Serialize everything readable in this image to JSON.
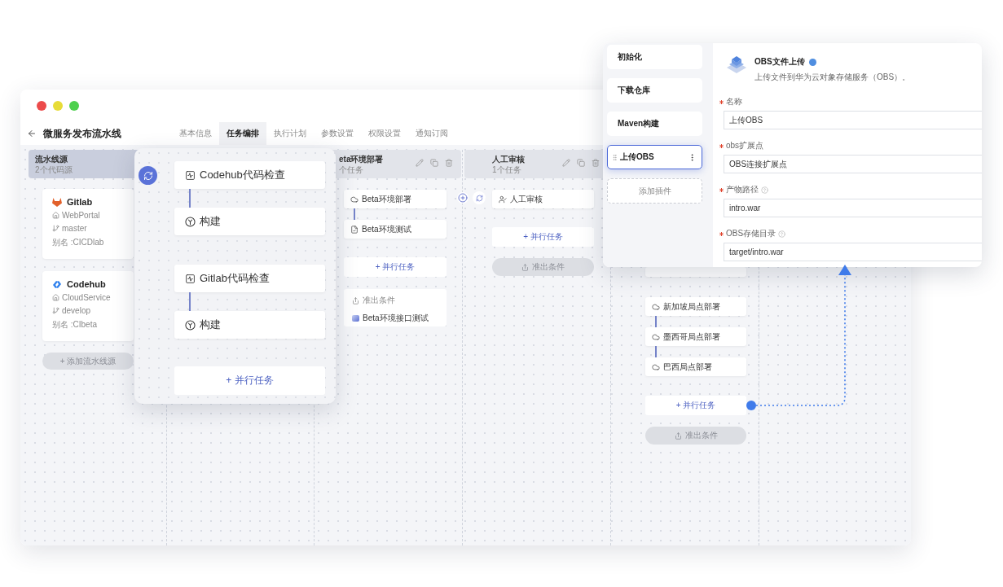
{
  "window": {
    "title": "微服务发布流水线",
    "tabs": [
      {
        "label": "基本信息",
        "selected": false
      },
      {
        "label": "任务编排",
        "selected": true
      },
      {
        "label": "执行计划",
        "selected": false
      },
      {
        "label": "参数设置",
        "selected": false
      },
      {
        "label": "权限设置",
        "selected": false
      },
      {
        "label": "通知订阅",
        "selected": false
      }
    ]
  },
  "source_column": {
    "title": "流水线源",
    "subtitle": "2个代码源",
    "repos": [
      {
        "kind": "gitlab",
        "name": "Gitlab",
        "project": "WebPortal",
        "branch": "master",
        "alias": "别名 :CICDlab"
      },
      {
        "kind": "codehub",
        "name": "Codehub",
        "project": "CloudService",
        "branch": "develop",
        "alias": "别名 :CIbeta"
      }
    ],
    "add_button": "+ 添加流水线源"
  },
  "stages": [
    {
      "title": "eta环境部署",
      "subtitle": "个任务",
      "groups": [
        {
          "tasks": [
            {
              "kind": "deploy",
              "label": "Beta环境部署"
            },
            {
              "kind": "test",
              "label": "Beta环境测试"
            }
          ]
        }
      ],
      "parallel_button": "+ 并行任务",
      "exit": {
        "kind": "card",
        "label": "准出条件",
        "item": "Beta环境接口测试"
      }
    },
    {
      "title": "人工审核",
      "subtitle": "1个任务",
      "groups": [
        {
          "tasks": [
            {
              "kind": "review",
              "label": "人工审核"
            }
          ]
        }
      ],
      "parallel_button": "+ 并行任务",
      "exit": {
        "kind": "button",
        "label": "准出条件"
      }
    },
    {
      "groups": [
        {
          "tasks": [
            {
              "kind": "partial"
            }
          ]
        },
        {
          "tasks": [
            {
              "kind": "deploy",
              "label": "新加坡局点部署"
            },
            {
              "kind": "deploy",
              "label": "墨西哥局点部署"
            },
            {
              "kind": "deploy",
              "label": "巴西局点部署"
            }
          ]
        }
      ],
      "parallel_button": "+ 并行任务",
      "exit": {
        "kind": "button",
        "label": "准出条件"
      }
    }
  ],
  "parallel_panel": {
    "groups": [
      {
        "tasks": [
          {
            "kind": "check",
            "label": "Codehub代码检查"
          },
          {
            "kind": "build",
            "label": "构建"
          }
        ]
      },
      {
        "tasks": [
          {
            "kind": "check",
            "label": "Gitlab代码检查"
          },
          {
            "kind": "build",
            "label": "构建"
          }
        ]
      }
    ],
    "parallel_button": "+ 并行任务"
  },
  "plugin_panel": {
    "steps": [
      {
        "label": "初始化",
        "selected": false
      },
      {
        "label": "下载仓库",
        "selected": false
      },
      {
        "label": "Maven构建",
        "selected": false
      },
      {
        "label": "上传OBS",
        "selected": true
      }
    ],
    "add_button": "添加插件",
    "plugin": {
      "name": "OBS文件上传",
      "description": "上传文件到华为云对象存储服务（OBS）。"
    },
    "fields": [
      {
        "label": "名称",
        "required": true,
        "help": false,
        "value": "上传OBS"
      },
      {
        "label": "obs扩展点",
        "required": true,
        "help": false,
        "value": "OBS连接扩展点"
      },
      {
        "label": "产物路径",
        "required": true,
        "help": true,
        "value": "intro.war"
      },
      {
        "label": "OBS存储目录",
        "required": true,
        "help": true,
        "value": "target/intro.war"
      }
    ]
  }
}
